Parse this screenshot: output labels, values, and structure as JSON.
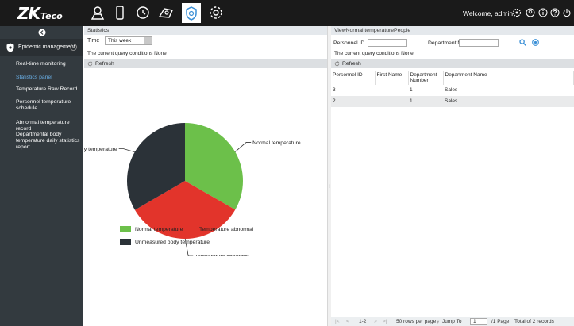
{
  "app": {
    "logo_main": "ZK",
    "logo_sub": "Teco",
    "welcome": "Welcome, admin"
  },
  "top_icons": [
    "personnel-icon",
    "device-icon",
    "attendance-clock-icon",
    "access-icon",
    "temperature-shield-icon",
    "settings-icon"
  ],
  "right_icons": [
    "theme-icon",
    "user-icon",
    "info-icon",
    "help-icon",
    "power-icon"
  ],
  "sidebar": {
    "module": "Epidemic management",
    "items": [
      {
        "label": "Real-time monitoring",
        "active": false
      },
      {
        "label": "Statistics panel",
        "active": true
      },
      {
        "label": "Temperature Raw Record",
        "active": false
      },
      {
        "label": "Personnel temperature schedule",
        "active": false
      },
      {
        "label": "Abnormal temperature record",
        "active": false
      },
      {
        "label": "Departmental body temperature daily statistics report",
        "active": false
      }
    ]
  },
  "left_panel": {
    "title": "Statistics",
    "time_label": "Time",
    "time_value": "This week",
    "conditions": "The current query conditions None",
    "refresh": "Refresh"
  },
  "chart_data": {
    "type": "pie",
    "slices": [
      {
        "label": "Normal temperature",
        "value": 33.3,
        "color": "#6cc04a"
      },
      {
        "label": "Temperature abnormal",
        "value": 33.3,
        "color": "#e2342b"
      },
      {
        "label": "Unmeasured body temperature",
        "value": 33.4,
        "color": "#2b3238"
      }
    ],
    "slice_labels": [
      "Normal temperature",
      "Temperature abnormal",
      "dy temperature"
    ],
    "legend": [
      "Normal temperature",
      "Temperature abnormal",
      "Unmeasured body temperature"
    ],
    "legend_position": "bottom"
  },
  "right_panel": {
    "title": "ViewNormal temperaturePeople",
    "personnel_id_label": "Personnel ID",
    "department_name_label": "Department Name",
    "personnel_id_value": "",
    "department_name_value": "",
    "conditions": "The current query conditions None",
    "refresh": "Refresh",
    "columns": [
      "Personnel ID",
      "First Name",
      "Department Number",
      "Department Name"
    ],
    "rows": [
      {
        "id": "3",
        "first_name": "",
        "dept_no": "1",
        "dept_name": "Sales"
      },
      {
        "id": "2",
        "first_name": "",
        "dept_no": "1",
        "dept_name": "Sales"
      }
    ],
    "pager": {
      "range": "1-2",
      "per_page": "50 rows per page",
      "jump_to": "Jump To",
      "page_value": "1",
      "page_total": "/1 Page",
      "total": "Total of 2 records"
    }
  }
}
